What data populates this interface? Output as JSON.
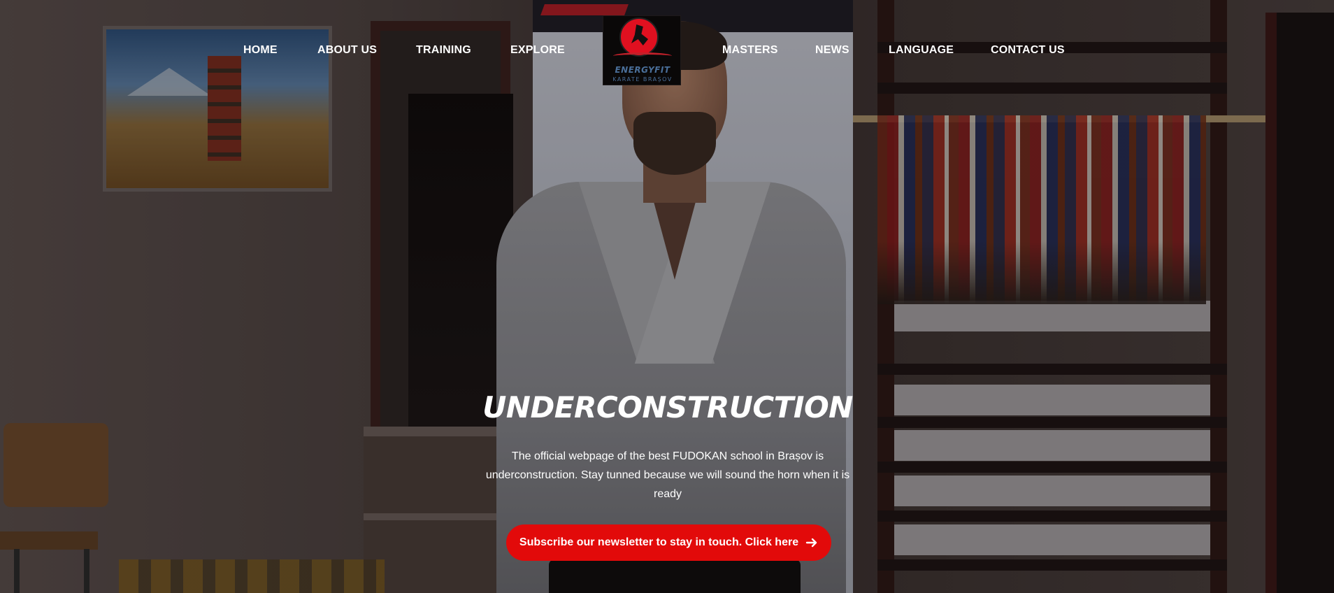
{
  "nav": {
    "left": [
      "HOME",
      "ABOUT US",
      "TRAINING",
      "EXPLORE"
    ],
    "right": [
      "MASTERS",
      "NEWS",
      "LANGUAGE",
      "CONTACT US"
    ]
  },
  "logo": {
    "brand": "ENERGYFIT",
    "subtitle": "KARATE BRAȘOV",
    "icon": "karate-fighter-red-circle-logo"
  },
  "hero": {
    "title": "UNDERCONSTRUCTION",
    "text": "The official webpage of the best FUDOKAN school in Brașov is underconstruction. Stay tunned because we will sound the horn when it is ready",
    "cta_label": "Subscribe our newsletter to stay in touch. Click here",
    "cta_icon": "arrow-right-icon"
  },
  "colors": {
    "accent": "#e20a0a",
    "nav_text": "#ffffff"
  }
}
